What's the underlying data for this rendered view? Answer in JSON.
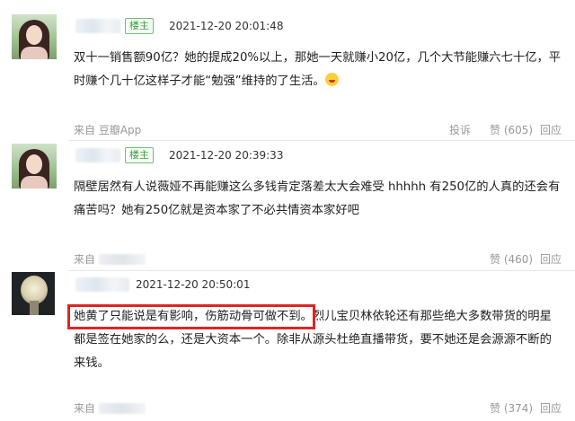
{
  "comments": [
    {
      "badge": "楼主",
      "time": "2021-12-20 20:01:48",
      "line1": "双十一销售额90亿？她的提成20%以上，那她一天就赚小20亿，几个大节能赚六七十亿，平",
      "line2": "时赚个几十亿这样子才能“勉强”维持的了生活。",
      "emoji_icon": "laughing-emoji-icon",
      "source": "来自 豆瓣App",
      "report": "投诉",
      "likes": "赞 (605)",
      "reply": "回应"
    },
    {
      "badge": "楼主",
      "time": "2021-12-20 20:39:33",
      "line1": "隔壁居然有人说薇娅不再能赚这么多钱肯定落差太大会难受 hhhhh 有250亿的人真的还会有",
      "line2": "痛苦吗？她有250亿就是资本家了不必共情资本家好吧",
      "source_prefix": "来自",
      "likes": "赞 (460)",
      "reply": "回应"
    },
    {
      "time": "2021-12-20 20:50:01",
      "highlight": "她黄了只能说是有影响，伤筋动骨可做不到。",
      "line1_rest": "烈儿宝贝林依轮还有那些绝大多数带货的明星",
      "line2": "都是签在她家的么，还是大资本一个。除非从源头杜绝直播带货，要不她还是会源源不断的",
      "line3": "来钱。",
      "source_prefix": "来自",
      "likes": "赞 (374)",
      "reply": "回应"
    }
  ],
  "colors": {
    "badge_green": "#3a9b3e",
    "highlight_red": "#e02424",
    "meta_gray": "#999999"
  }
}
